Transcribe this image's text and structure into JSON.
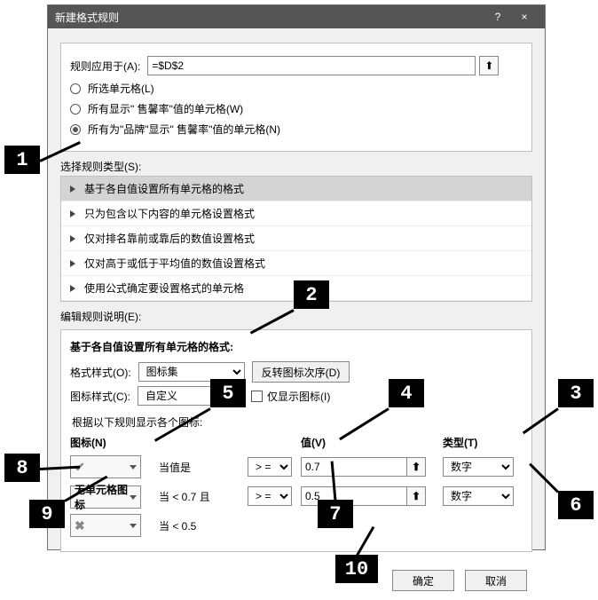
{
  "window": {
    "title": "新建格式规则",
    "help": "?",
    "close": "×"
  },
  "applyTo": {
    "label": "规则应用于(A):",
    "value": "=$D$2"
  },
  "scope": {
    "opt1": "所选单元格(L)",
    "opt2": "所有显示\" 售馨率\"值的单元格(W)",
    "opt3": "所有为\"品牌\"显示\" 售馨率\"值的单元格(N)",
    "selectedIndex": 2
  },
  "ruleTypeLabel": "选择规则类型(S):",
  "ruleTypes": {
    "items": [
      "基于各自值设置所有单元格的格式",
      "只为包含以下内容的单元格设置格式",
      "仅对排名靠前或靠后的数值设置格式",
      "仅对高于或低于平均值的数值设置格式",
      "使用公式确定要设置格式的单元格"
    ],
    "selectedIndex": 0
  },
  "editLabel": "编辑规则说明(E):",
  "editLegend": "基于各自值设置所有单元格的格式:",
  "formatStyle": {
    "label": "格式样式(O):",
    "value": "图标集"
  },
  "reverseBtn": "反转图标次序(D)",
  "iconStyle": {
    "label": "图标样式(C):",
    "value": "自定义"
  },
  "showOnly": "仅显示图标(I)",
  "rulesNote": "根据以下规则显示各个图标:",
  "headers": {
    "icon": "图标(N)",
    "value": "值(V)",
    "type": "类型(T)"
  },
  "rows": {
    "r1": {
      "when": "当值是",
      "op": "> =",
      "val": "0.7",
      "type": "数字",
      "iconGlyph": "✔"
    },
    "r2": {
      "iconLabel": "无单元格图标",
      "when": "当 < 0.7 且",
      "op": "> =",
      "val": "0.5",
      "type": "数字"
    },
    "r3": {
      "when": "当 < 0.5",
      "iconGlyph": "✖"
    }
  },
  "footer": {
    "ok": "确定",
    "cancel": "取消"
  },
  "callouts": {
    "c1": "1",
    "c2": "2",
    "c3": "3",
    "c4": "4",
    "c5": "5",
    "c6": "6",
    "c7": "7",
    "c8": "8",
    "c9": "9",
    "c10": "10"
  }
}
